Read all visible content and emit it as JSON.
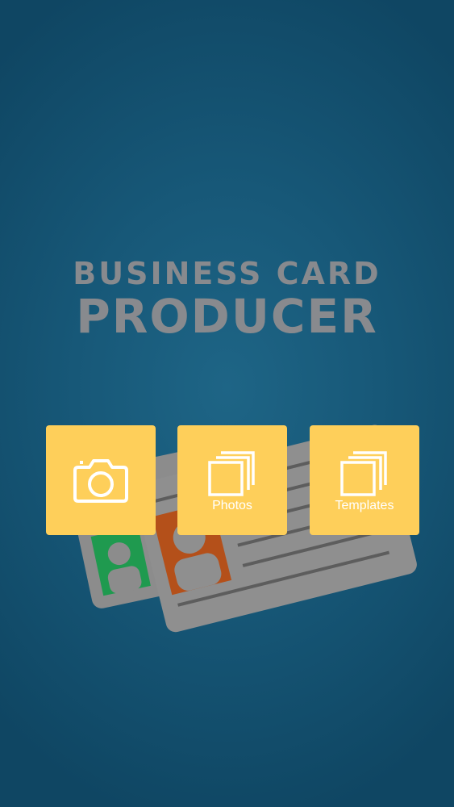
{
  "app": {
    "title_line1": "Business Card",
    "title_line2": "Producer"
  },
  "menu": {
    "items": [
      {
        "id": "camera",
        "label": "",
        "icon": "camera-icon"
      },
      {
        "id": "photos",
        "label": "Photos",
        "icon": "stacked-squares-icon"
      },
      {
        "id": "templates",
        "label": "Templates",
        "icon": "stacked-squares-icon"
      }
    ]
  },
  "colors": {
    "background": "#175878",
    "tile": "#fecf5a",
    "title": "#888a8e",
    "card": "#8f8f8f"
  }
}
